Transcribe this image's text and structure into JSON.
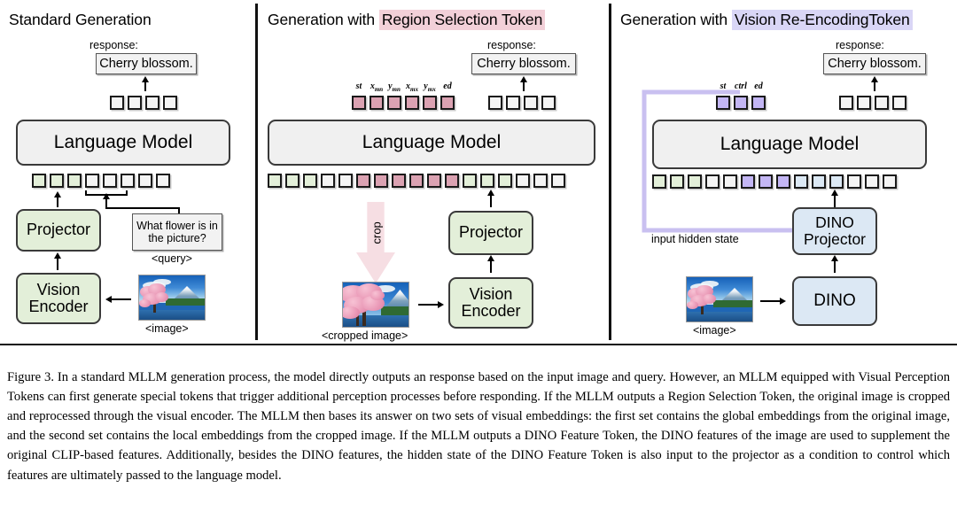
{
  "figure": {
    "panels": [
      {
        "id": "standard",
        "title_prefix": "Standard Generation",
        "title_highlight": "",
        "response_label": "response:",
        "response_text": "Cherry blossom.",
        "output_tokens": [
          "white",
          "white",
          "white",
          "white"
        ],
        "input_tokens": [
          "green",
          "green",
          "green",
          "white",
          "white",
          "white",
          "white",
          "white"
        ],
        "lm_label": "Language Model",
        "projector_label": "Projector",
        "encoder_label": "Vision Encoder",
        "query_text": "What flower is in the picture?",
        "query_caption": "<query>",
        "image_caption": "<image>"
      },
      {
        "id": "region-selection",
        "title_prefix": "Generation with ",
        "title_highlight": "Region Selection Token",
        "response_label": "response:",
        "response_text": "Cherry blossom.",
        "output_tokens": [
          "white",
          "white",
          "white",
          "white"
        ],
        "special_tokens": [
          "pink",
          "pink",
          "pink",
          "pink",
          "pink",
          "pink"
        ],
        "special_token_labels": [
          "st",
          "x_mn",
          "y_mn",
          "x_mx",
          "y_mx",
          "ed"
        ],
        "input_tokens": [
          "green",
          "green",
          "green",
          "white",
          "white",
          "pink",
          "pink",
          "pink",
          "pink",
          "pink",
          "pink",
          "green",
          "green",
          "green",
          "white",
          "white",
          "white"
        ],
        "lm_label": "Language Model",
        "projector_label": "Projector",
        "encoder_label": "Vision Encoder",
        "crop_label": "crop",
        "image_caption": "<cropped image>"
      },
      {
        "id": "vision-re-encoding",
        "title_prefix": "Generation with ",
        "title_highlight": "Vision Re-EncodingToken",
        "response_label": "response:",
        "response_text": "Cherry blossom.",
        "output_tokens": [
          "white",
          "white",
          "white",
          "white"
        ],
        "special_tokens": [
          "purple",
          "purple",
          "purple"
        ],
        "special_token_labels": [
          "st",
          "ctrl",
          "ed"
        ],
        "input_tokens": [
          "green",
          "green",
          "green",
          "white",
          "white",
          "purple",
          "purple",
          "purple",
          "blue",
          "blue",
          "blue",
          "white",
          "white",
          "white"
        ],
        "lm_label": "Language Model",
        "projector_label": "DINO Projector",
        "encoder_label": "DINO",
        "loop_label": "input hidden state",
        "image_caption": "<image>"
      }
    ],
    "colors": {
      "token_white": "#f4f4f4",
      "token_green": "#e3efd9",
      "token_pink": "#dba2b2",
      "token_purple": "#c3b6f4",
      "token_blue": "#dce9f5",
      "highlight_pink": "#f2d0d8",
      "highlight_purple": "#d9d6f6",
      "box_grey": "#f0f0f0",
      "box_green": "#e3efd9",
      "box_blue": "#dce8f4",
      "crop_arrow": "#f6dee3",
      "loop_arrow": "#c9c0f0"
    }
  },
  "caption": {
    "number": "Figure 3.",
    "text": "Figure 3. In a standard MLLM generation process, the model directly outputs an response based on the input image and query. However, an MLLM equipped with Visual Perception Tokens can first generate special tokens that trigger additional perception processes before responding. If the MLLM outputs a Region Selection Token, the original image is cropped and reprocessed through the visual encoder. The MLLM then bases its answer on two sets of visual embeddings: the first set contains the global embeddings from the original image, and the second set contains the local embeddings from the cropped image. If the MLLM outputs a DINO Feature Token, the DINO features of the image are used to supplement the original CLIP-based features. Additionally, besides the DINO features, the hidden state of the DINO Feature Token is also input to the projector as a condition to control which features are ultimately passed to the language model."
  }
}
